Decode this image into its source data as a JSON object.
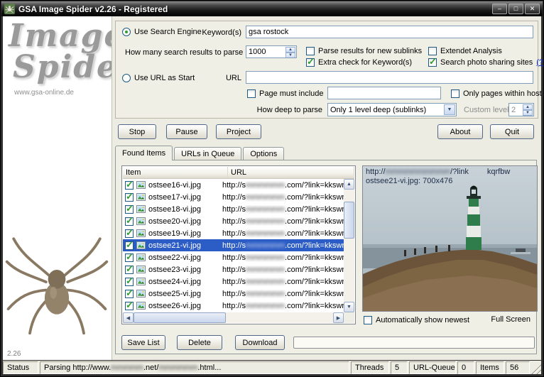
{
  "window": {
    "title": "GSA Image Spider v2.26 - Registered",
    "controls": {
      "minimize": "–",
      "maximize": "□",
      "close": "✕"
    }
  },
  "sidebar": {
    "logo1": "Image",
    "logo2": "Spider",
    "site": "www.gsa-online.de",
    "version": "2.26"
  },
  "search": {
    "use_search_engine_label": "Use Search Engine",
    "keywords_label": "Keyword(s)",
    "keywords_value": "gsa rostock",
    "results_label": "How many search results to parse",
    "results_value": "1000",
    "parse_sublinks_label": "Parse results for new sublinks",
    "extra_check_label": "Extra check for Keyword(s)",
    "extended_analysis_label": "Extendet Analysis",
    "photo_sites_label": "Search photo sharing sites",
    "help_link": "(?)",
    "use_url_label": "Use URL as Start",
    "url_label": "URL",
    "url_value": "",
    "page_include_label": "Page must include",
    "page_include_value": "",
    "only_host_label": "Only pages within host",
    "depth_label": "How deep to parse",
    "depth_value": "Only 1 level deep (sublinks)",
    "custom_level_label": "Custom level",
    "custom_level_value": "2",
    "states": {
      "use_search_engine": true,
      "use_url": false,
      "parse_sublinks": false,
      "extra_check": true,
      "extended_analysis": false,
      "photo_sites": true,
      "page_include": false,
      "only_host": false
    }
  },
  "toolbar": {
    "stop": "Stop",
    "pause": "Pause",
    "project": "Project",
    "about": "About",
    "quit": "Quit"
  },
  "tabs": {
    "found": "Found Items",
    "queue": "URLs in Queue",
    "options": "Options"
  },
  "list": {
    "col_item": "Item",
    "col_url": "URL",
    "url_prefix": "http://s",
    "url_blur": "mmmmmm",
    "url_suffix": ".com/?link=kkswr",
    "selected_index": 5,
    "rows": [
      {
        "name": "ostsee16-vi.jpg",
        "checked": true
      },
      {
        "name": "ostsee17-vi.jpg",
        "checked": true
      },
      {
        "name": "ostsee18-vi.jpg",
        "checked": true
      },
      {
        "name": "ostsee20-vi.jpg",
        "checked": true
      },
      {
        "name": "ostsee19-vi.jpg",
        "checked": true
      },
      {
        "name": "ostsee21-vi.jpg",
        "checked": true
      },
      {
        "name": "ostsee22-vi.jpg",
        "checked": true
      },
      {
        "name": "ostsee23-vi.jpg",
        "checked": true
      },
      {
        "name": "ostsee24-vi.jpg",
        "checked": true
      },
      {
        "name": "ostsee25-vi.jpg",
        "checked": true
      },
      {
        "name": "ostsee26-vi.jpg",
        "checked": true
      }
    ]
  },
  "preview": {
    "url_prefix": "http://",
    "url_blur": "mmmmmmmmmm",
    "url_mid": "/?link",
    "url_tail": "kqrfbw",
    "caption": "ostsee21-vi.jpg: 700x476",
    "auto_label": "Automatically show newest",
    "auto_checked": false,
    "fullscreen": "Full Screen"
  },
  "actions": {
    "save": "Save List",
    "delete": "Delete",
    "download": "Download"
  },
  "status": {
    "label": "Status",
    "parsing_prefix": "Parsing http://www.",
    "parsing_blur": "mmmmm",
    "parsing_mid": ".net/",
    "parsing_blur2": "mmmmmm",
    "parsing_suffix": ".html...",
    "threads_label": "Threads",
    "threads_value": "5",
    "queue_label": "URL-Queue",
    "queue_value": "0",
    "items_label": "Items",
    "items_value": "56"
  }
}
